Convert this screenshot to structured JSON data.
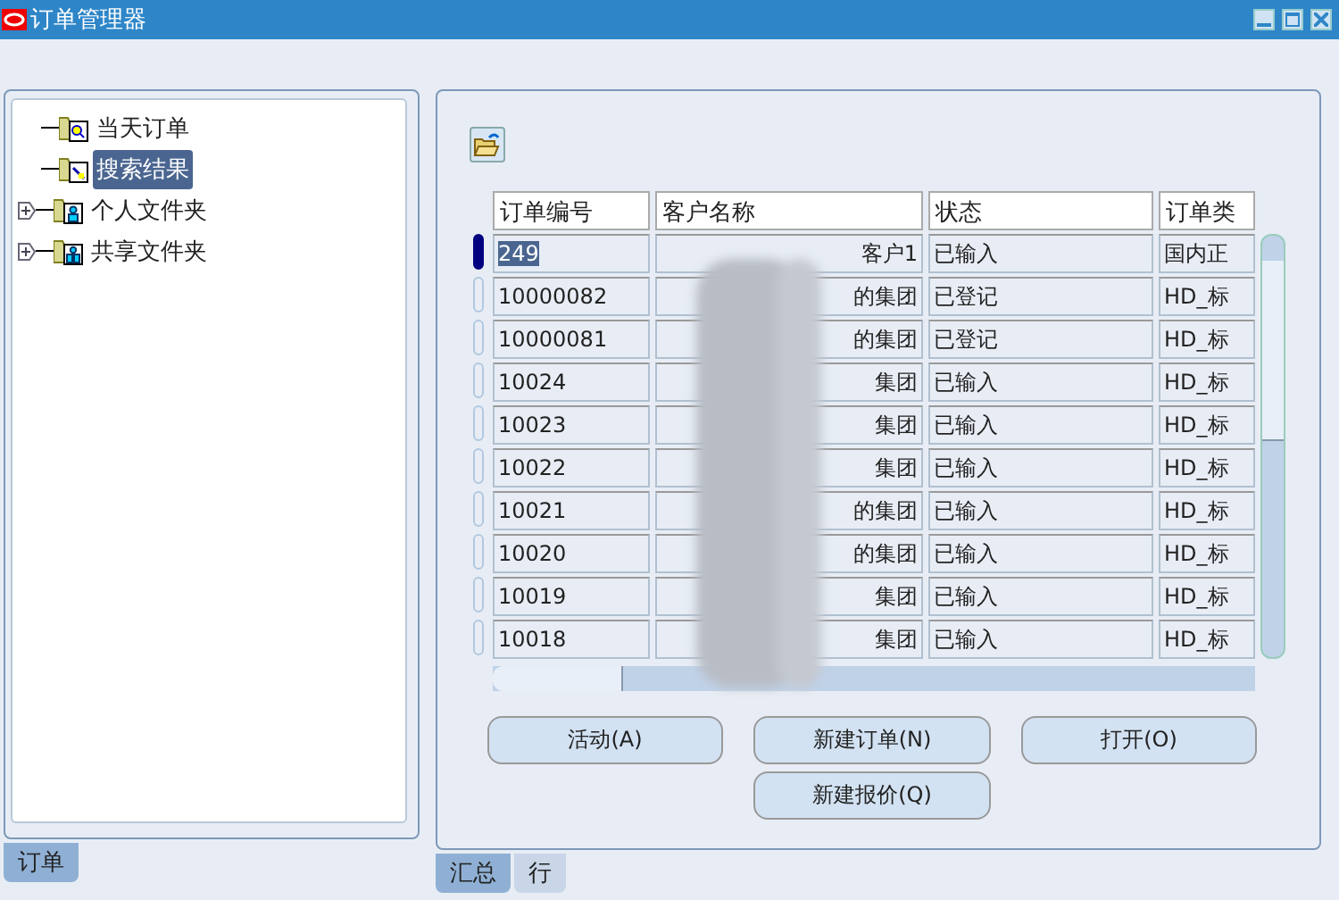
{
  "window": {
    "title": "订单管理器"
  },
  "tree": [
    {
      "label": "当天订单",
      "selected": false,
      "expandable": false,
      "kind": "search"
    },
    {
      "label": "搜索结果",
      "selected": true,
      "expandable": false,
      "kind": "edit"
    },
    {
      "label": "个人文件夹",
      "selected": false,
      "expandable": true,
      "kind": "person"
    },
    {
      "label": "共享文件夹",
      "selected": false,
      "expandable": true,
      "kind": "people"
    }
  ],
  "left_tabs": [
    {
      "label": "订单",
      "selected": true
    }
  ],
  "table": {
    "columns": [
      "订单编号",
      "客户名称",
      "状态",
      "订单类"
    ],
    "rows": [
      {
        "selected": true,
        "cells": [
          "249",
          "客户1",
          "已输入",
          "国内正"
        ]
      },
      {
        "selected": false,
        "cells": [
          "10000082",
          "的集团",
          "已登记",
          "HD_标"
        ]
      },
      {
        "selected": false,
        "cells": [
          "10000081",
          "的集团",
          "已登记",
          "HD_标"
        ]
      },
      {
        "selected": false,
        "cells": [
          "10024",
          "集团",
          "已输入",
          "HD_标"
        ]
      },
      {
        "selected": false,
        "cells": [
          "10023",
          "集团",
          "已输入",
          "HD_标"
        ]
      },
      {
        "selected": false,
        "cells": [
          "10022",
          "集团",
          "已输入",
          "HD_标"
        ]
      },
      {
        "selected": false,
        "cells": [
          "10021",
          "的集团",
          "已输入",
          "HD_标"
        ]
      },
      {
        "selected": false,
        "cells": [
          "10020",
          "的集团",
          "已输入",
          "HD_标"
        ]
      },
      {
        "selected": false,
        "cells": [
          "10019",
          "集团",
          "已输入",
          "HD_标"
        ]
      },
      {
        "selected": false,
        "cells": [
          "10018",
          "集团",
          "已输入",
          "HD_标"
        ]
      }
    ]
  },
  "buttons": [
    "活动(A)",
    "新建订单(N)",
    "打开(O)",
    "新建报价(Q)"
  ],
  "right_tabs": [
    {
      "label": "汇总",
      "selected": true
    },
    {
      "label": "行",
      "selected": false
    }
  ]
}
